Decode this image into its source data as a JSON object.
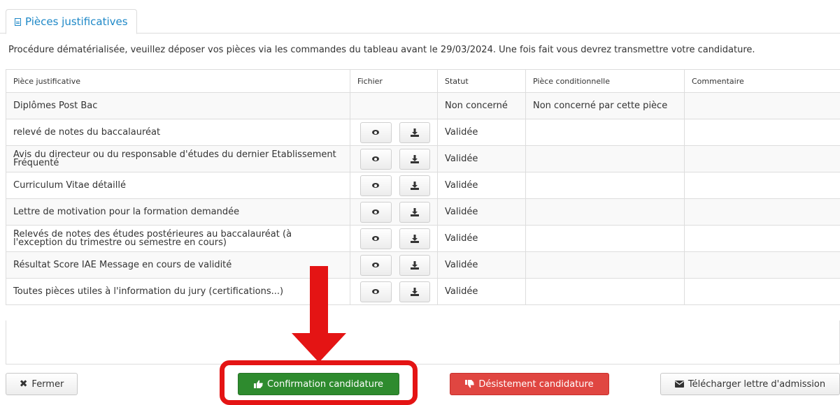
{
  "tab": {
    "label": "Pièces justificatives",
    "icon": "file-icon"
  },
  "notice": "Procédure dématérialisée, veuillez déposer vos pièces via les commandes du tableau avant le 29/03/2024. Une fois fait vous devrez transmettre votre candidature.",
  "table": {
    "headers": [
      "Pièce justificative",
      "Fichier",
      "Statut",
      "Pièce conditionnelle",
      "Commentaire"
    ],
    "rows": [
      {
        "piece": "Diplômes Post Bac",
        "statut": "Non concerné",
        "conditionnelle": "Non concerné par cette pièce",
        "commentaire": "",
        "has_file": false
      },
      {
        "piece": "relevé de notes du baccalauréat",
        "statut": "Validée",
        "conditionnelle": "",
        "commentaire": "",
        "has_file": true
      },
      {
        "piece": "Avis du directeur ou du responsable d'études du dernier Etablissement Fréquenté",
        "statut": "Validée",
        "conditionnelle": "",
        "commentaire": "",
        "has_file": true,
        "small": true
      },
      {
        "piece": "Curriculum Vitae détaillé",
        "statut": "Validée",
        "conditionnelle": "",
        "commentaire": "",
        "has_file": true
      },
      {
        "piece": "Lettre de motivation pour la formation demandée",
        "statut": "Validée",
        "conditionnelle": "",
        "commentaire": "",
        "has_file": true
      },
      {
        "piece": "Relevés de notes des études postérieures au baccalauréat (à l'exception du trimestre ou semestre en cours)",
        "statut": "Validée",
        "conditionnelle": "",
        "commentaire": "",
        "has_file": true,
        "small": true
      },
      {
        "piece": "Résultat Score IAE Message en cours de validité",
        "statut": "Validée",
        "conditionnelle": "",
        "commentaire": "",
        "has_file": true
      },
      {
        "piece": "Toutes pièces utiles à l'information du jury (certifications...)",
        "statut": "Validée",
        "conditionnelle": "",
        "commentaire": "",
        "has_file": true
      }
    ]
  },
  "buttons": {
    "close": "Fermer",
    "confirm": "Confirmation candidature",
    "withdraw": "Désistement candidature",
    "download": "Télécharger lettre d'admission"
  },
  "icons": {
    "view": "eye-icon",
    "download": "download-icon",
    "close": "times-icon",
    "confirm": "thumbs-up-icon",
    "withdraw": "thumbs-down-icon",
    "mail": "envelope-icon"
  },
  "colors": {
    "tab_link": "#1e88c7",
    "confirm_button": "#2e8b2e",
    "withdraw_button": "#e04641",
    "annotation": "#e41414"
  }
}
